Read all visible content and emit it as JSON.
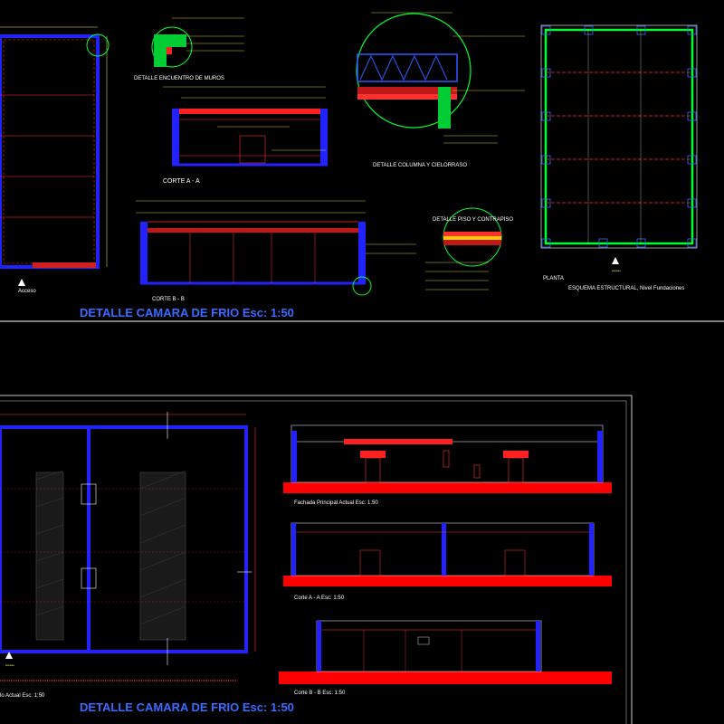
{
  "colors": {
    "background": "#000000",
    "wall": "#2222ff",
    "grid_red": "#ff2020",
    "structure_green": "#00ff33",
    "leader_yellow": "#ffff33",
    "text_white": "#ffffff",
    "title_blue": "#3a6bff",
    "floor_red": "#ff0000",
    "border_white": "#ffffff"
  },
  "upper_sheet": {
    "title": "DETALLE CAMARA DE FRIO Esc: 1:50",
    "labels": {
      "detalle_encuentro": "DETALLE ENCUENTRO DE MUROS",
      "corte_aa": "CORTE A - A",
      "corte_bb": "CORTE B - B",
      "detalle_columna": "DETALLE COLUMNA Y CIELORRASO",
      "detalle_piso": "DETALLE PISO Y CONTRAPISO",
      "planta": "PLANTA",
      "esquema": "ESQUEMA ESTRUCTURAL, Nivel Fundaciones",
      "acceso": "Acceso"
    }
  },
  "lower_sheet": {
    "title": "DETALLE CAMARA DE FRIO Esc: 1:50",
    "labels": {
      "fachada": "Fachada Principal Actual  Esc: 1:50",
      "corte_aa": "Corte A - A  Esc: 1:50",
      "corte_bb": "Corte B - B  Esc: 1:50",
      "planta_actual": "lo Actual  Esc: 1:50",
      "acceso": "Acceso"
    }
  }
}
